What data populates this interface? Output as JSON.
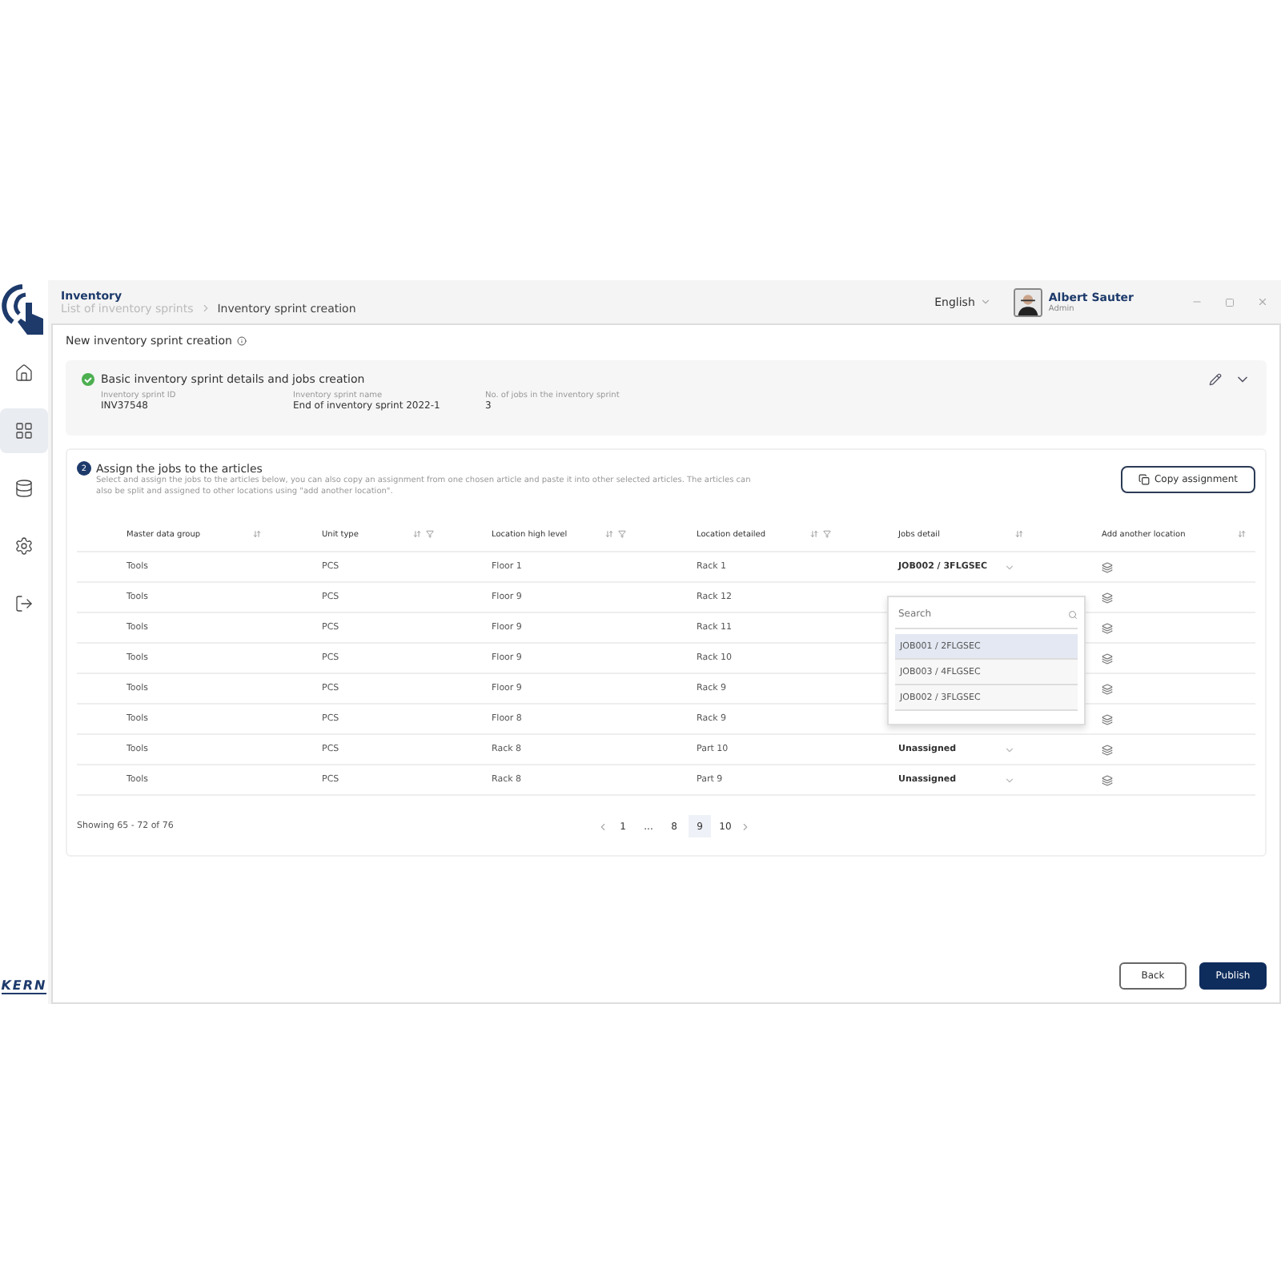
{
  "logo_text": "KERN",
  "header": {
    "title": "Inventory",
    "breadcrumbs": [
      "List of inventory sprints",
      "Inventory sprint creation"
    ],
    "language": "English",
    "user": {
      "name": "Albert Sauter",
      "role": "Admin"
    }
  },
  "nav": [
    {
      "selected": false
    },
    {
      "selected": true
    },
    {
      "selected": false
    },
    {
      "selected": false
    },
    {
      "selected": false
    }
  ],
  "page_title": "New inventory sprint creation",
  "details": {
    "completed": true,
    "title": "Basic inventory sprint details and jobs creation",
    "fields": [
      {
        "label": "Inventory sprint ID",
        "value": "INV37548"
      },
      {
        "label": "Inventory sprint name",
        "value": "End of inventory sprint 2022-1"
      },
      {
        "label": "No. of jobs in the inventory sprint",
        "value": "3"
      }
    ]
  },
  "assign": {
    "step": "2",
    "title": "Assign the jobs to the articles",
    "description": "Select and assign the jobs to the articles below, you can also copy an assignment from one chosen article and paste it into other selected articles. The articles can also be split and assigned to other locations using \"add another location\".",
    "copy_button": "Copy assignment",
    "columns": [
      {
        "label": "Master data group",
        "filter": false
      },
      {
        "label": "Unit type",
        "filter": true
      },
      {
        "label": "Location high level",
        "filter": true
      },
      {
        "label": "Location detailed",
        "filter": true
      },
      {
        "label": "Jobs detail",
        "filter": false
      },
      {
        "label": "Add another location",
        "filter": false
      }
    ],
    "rows": [
      {
        "group": "Tools",
        "unit": "PCS",
        "high": "Floor 1",
        "detailed": "Rack 1",
        "job": "JOB002 / 3FLGSEC"
      },
      {
        "group": "Tools",
        "unit": "PCS",
        "high": "Floor 9",
        "detailed": "Rack 12"
      },
      {
        "group": "Tools",
        "unit": "PCS",
        "high": "Floor 9",
        "detailed": "Rack 11"
      },
      {
        "group": "Tools",
        "unit": "PCS",
        "high": "Floor 9",
        "detailed": "Rack 10"
      },
      {
        "group": "Tools",
        "unit": "PCS",
        "high": "Floor 9",
        "detailed": "Rack 9"
      },
      {
        "group": "Tools",
        "unit": "PCS",
        "high": "Floor 8",
        "detailed": "Rack 9"
      },
      {
        "group": "Tools",
        "unit": "PCS",
        "high": "Rack 8",
        "detailed": "Part 10",
        "job": "Unassigned"
      },
      {
        "group": "Tools",
        "unit": "PCS",
        "high": "Rack 8",
        "detailed": "Part 9",
        "job": "Unassigned"
      }
    ],
    "dropdown": {
      "placeholder": "Search",
      "options": [
        {
          "label": "JOB001 / 2FLGSEC",
          "selected": true
        },
        {
          "label": "JOB003 / 4FLGSEC",
          "selected": false
        },
        {
          "label": "JOB002 / 3FLGSEC",
          "selected": false
        }
      ]
    },
    "summary": "Showing 65 - 72 of 76",
    "pages": [
      {
        "label": "1",
        "selected": false
      },
      {
        "label": "...",
        "selected": false
      },
      {
        "label": "8",
        "selected": false
      },
      {
        "label": "9",
        "selected": true
      },
      {
        "label": "10",
        "selected": false
      }
    ]
  },
  "buttons": [
    {
      "label": "Back",
      "kind": "secondary"
    },
    {
      "label": "Publish",
      "kind": "primary"
    }
  ]
}
